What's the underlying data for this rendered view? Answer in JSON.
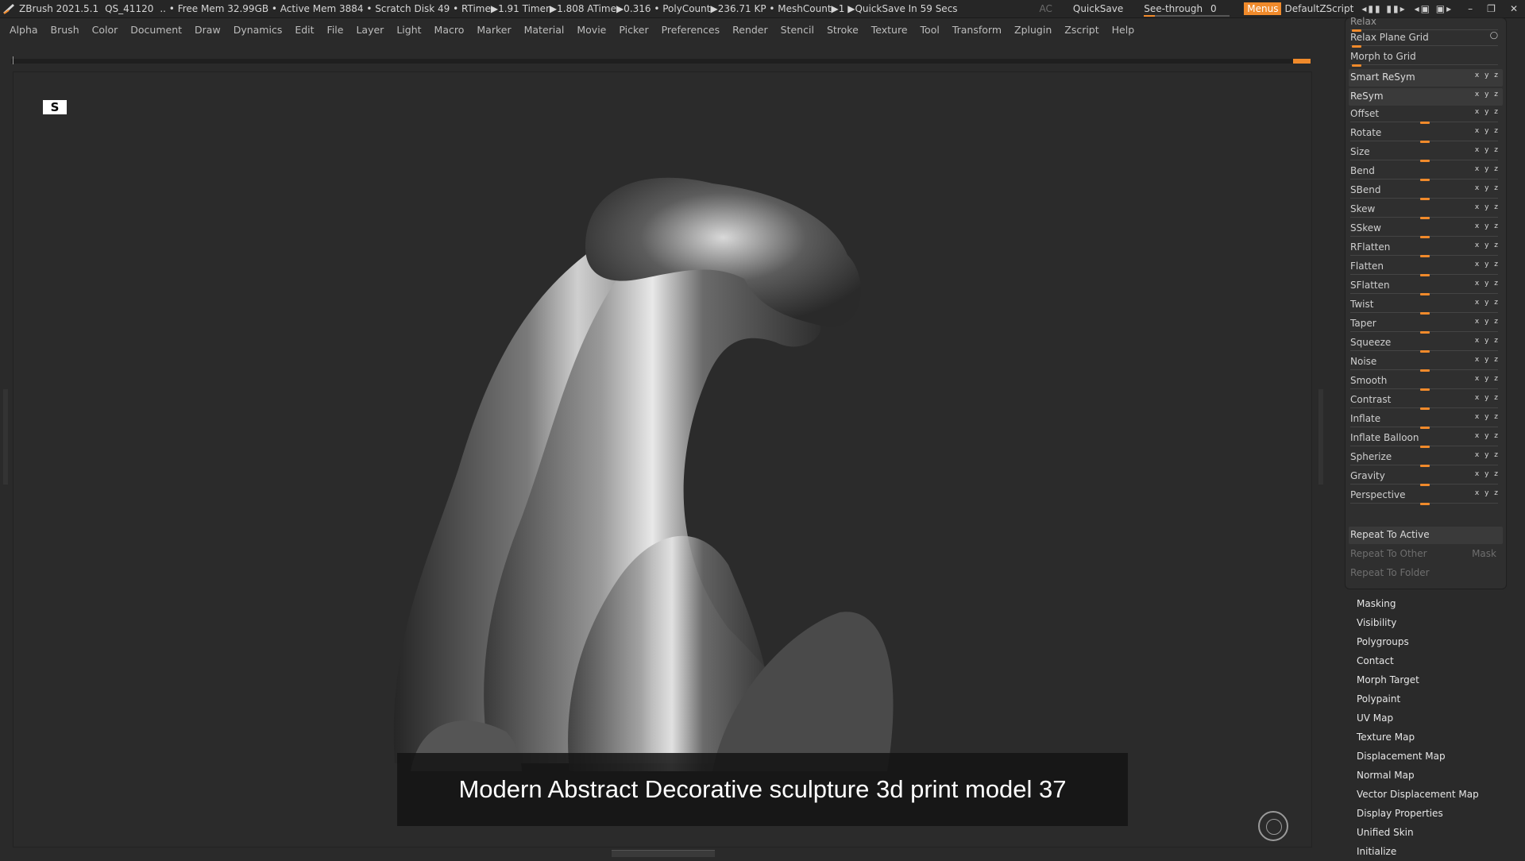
{
  "title_bar": {
    "app": "ZBrush 2021.5.1",
    "session": "QS_41120",
    "stats": ".. • Free Mem 32.99GB • Active Mem 3884 • Scratch Disk 49 •  RTime▶1.91 Timer▶1.808 ATime▶0.316 • PolyCount▶236.71 KP  • MeshCount▶1  ▶QuickSave In 59 Secs",
    "ac": "AC",
    "quicksave": "QuickSave",
    "see_through_label": "See-through",
    "see_through_value": "0",
    "menus": "Menus",
    "script": "DefaultZScript"
  },
  "menu_bar": [
    "Alpha",
    "Brush",
    "Color",
    "Document",
    "Draw",
    "Dynamics",
    "Edit",
    "File",
    "Layer",
    "Light",
    "Macro",
    "Marker",
    "Material",
    "Movie",
    "Picker",
    "Preferences",
    "Render",
    "Stencil",
    "Stroke",
    "Texture",
    "Tool",
    "Transform",
    "Zplugin",
    "Zscript",
    "Help"
  ],
  "caption": "Modern Abstract Decorative sculpture 3d print model 37",
  "deformation_panel": {
    "top_partial": "Relax",
    "relax_plane_grid": "Relax Plane Grid",
    "morph_to_grid": "Morph to Grid",
    "smart_resym": "Smart ReSym",
    "resym": "ReSym",
    "sliders": [
      "Offset",
      "Rotate",
      "Size",
      "Bend",
      "SBend",
      "Skew",
      "SSkew",
      "RFlatten",
      "Flatten",
      "SFlatten",
      "Twist",
      "Taper",
      "Squeeze",
      "Noise",
      "Smooth",
      "Contrast",
      "Inflate",
      "Inflate Balloon",
      "Spherize",
      "Gravity",
      "Perspective"
    ],
    "repeat_to_active": "Repeat To Active",
    "repeat_to_other": "Repeat To Other",
    "mask": "Mask",
    "repeat_to_folder": "Repeat To Folder"
  },
  "subpalettes": [
    "Masking",
    "Visibility",
    "Polygroups",
    "Contact",
    "Morph Target",
    "Polypaint",
    "UV Map",
    "Texture Map",
    "Displacement Map",
    "Normal Map",
    "Vector Displacement Map",
    "Display Properties",
    "Unified Skin",
    "Initialize"
  ],
  "colors": {
    "accent": "#f08a2b",
    "background": "#2a2a2a",
    "panel": "#2f2f2f"
  }
}
